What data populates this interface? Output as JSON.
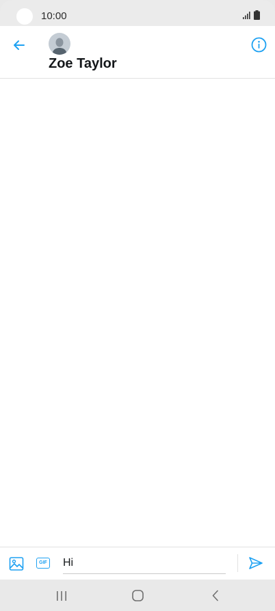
{
  "status_bar": {
    "time": "10:00"
  },
  "header": {
    "contact_name": "Zoe Taylor"
  },
  "composer": {
    "message_text": "Hi"
  },
  "colors": {
    "accent": "#1da1f2",
    "nav_icon": "#6f6f6f"
  },
  "icons": {
    "back": "arrow-left-icon",
    "info": "info-icon",
    "media": "image-icon",
    "gif": "gif-icon",
    "send": "send-icon"
  },
  "gif_label": "GIF"
}
